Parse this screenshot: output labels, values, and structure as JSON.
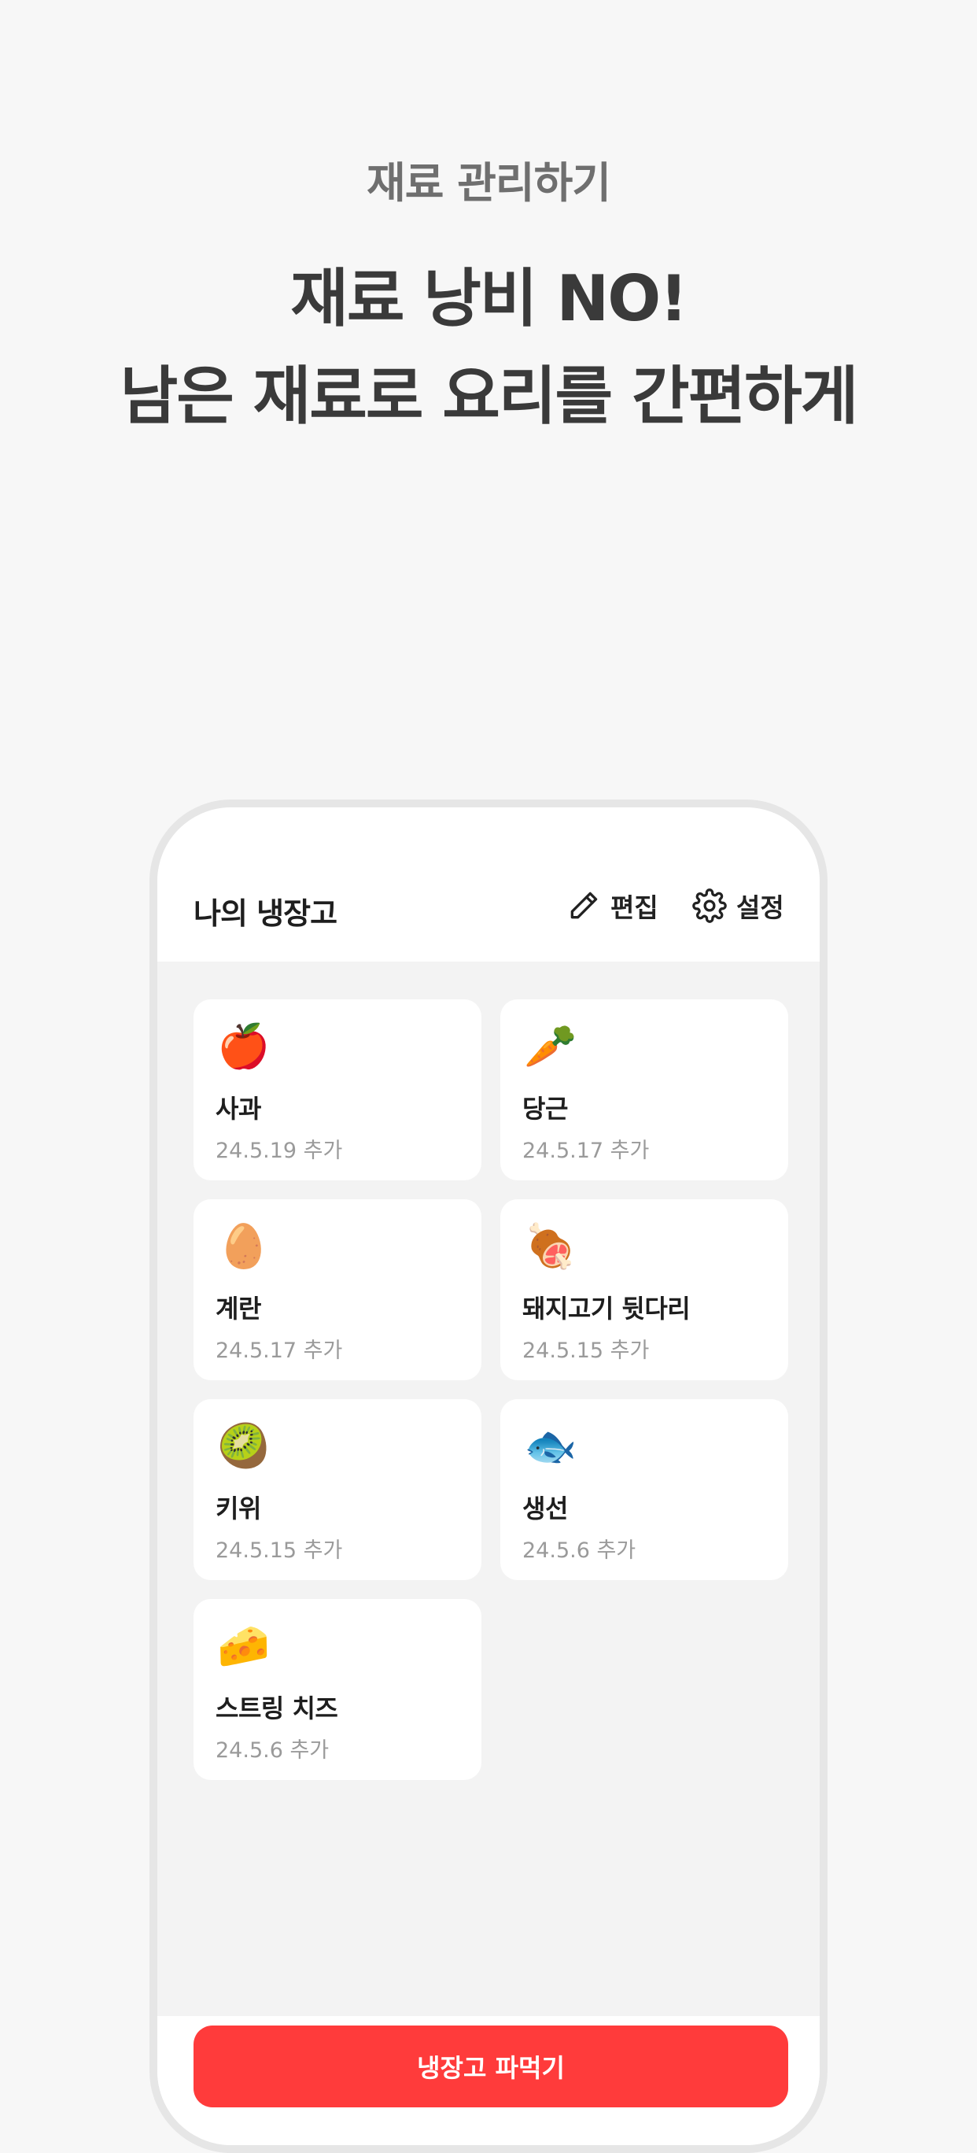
{
  "promo": {
    "subtitle": "재료 관리하기",
    "title_line1": "재료 낭비 NO!",
    "title_line2": "남은 재료로 요리를 간편하게"
  },
  "app": {
    "title": "나의 냉장고",
    "edit_label": "편집",
    "edit_icon": "pencil-icon",
    "settings_label": "설정",
    "settings_icon": "gear-icon"
  },
  "items": [
    {
      "emoji": "🍎",
      "icon": "apple-icon",
      "name": "사과",
      "date": "24.5.19 추가"
    },
    {
      "emoji": "🥕",
      "icon": "carrot-icon",
      "name": "당근",
      "date": "24.5.17 추가"
    },
    {
      "emoji": "🥚",
      "icon": "egg-icon",
      "name": "계란",
      "date": "24.5.17 추가"
    },
    {
      "emoji": "🍖",
      "icon": "meat-icon",
      "name": "돼지고기 뒷다리",
      "date": "24.5.15 추가"
    },
    {
      "emoji": "🥝",
      "icon": "kiwi-icon",
      "name": "키위",
      "date": "24.5.15 추가"
    },
    {
      "emoji": "🐟",
      "icon": "fish-icon",
      "name": "생선",
      "date": "24.5.6 추가"
    },
    {
      "emoji": "🧀",
      "icon": "cheese-icon",
      "name": "스트링 치즈",
      "date": "24.5.6 추가"
    }
  ],
  "cta": {
    "label": "냉장고 파먹기"
  },
  "colors": {
    "background": "#f7f7f7",
    "accent": "#ff3b3b",
    "card": "#ffffff",
    "date_text": "#9a9a9a"
  }
}
